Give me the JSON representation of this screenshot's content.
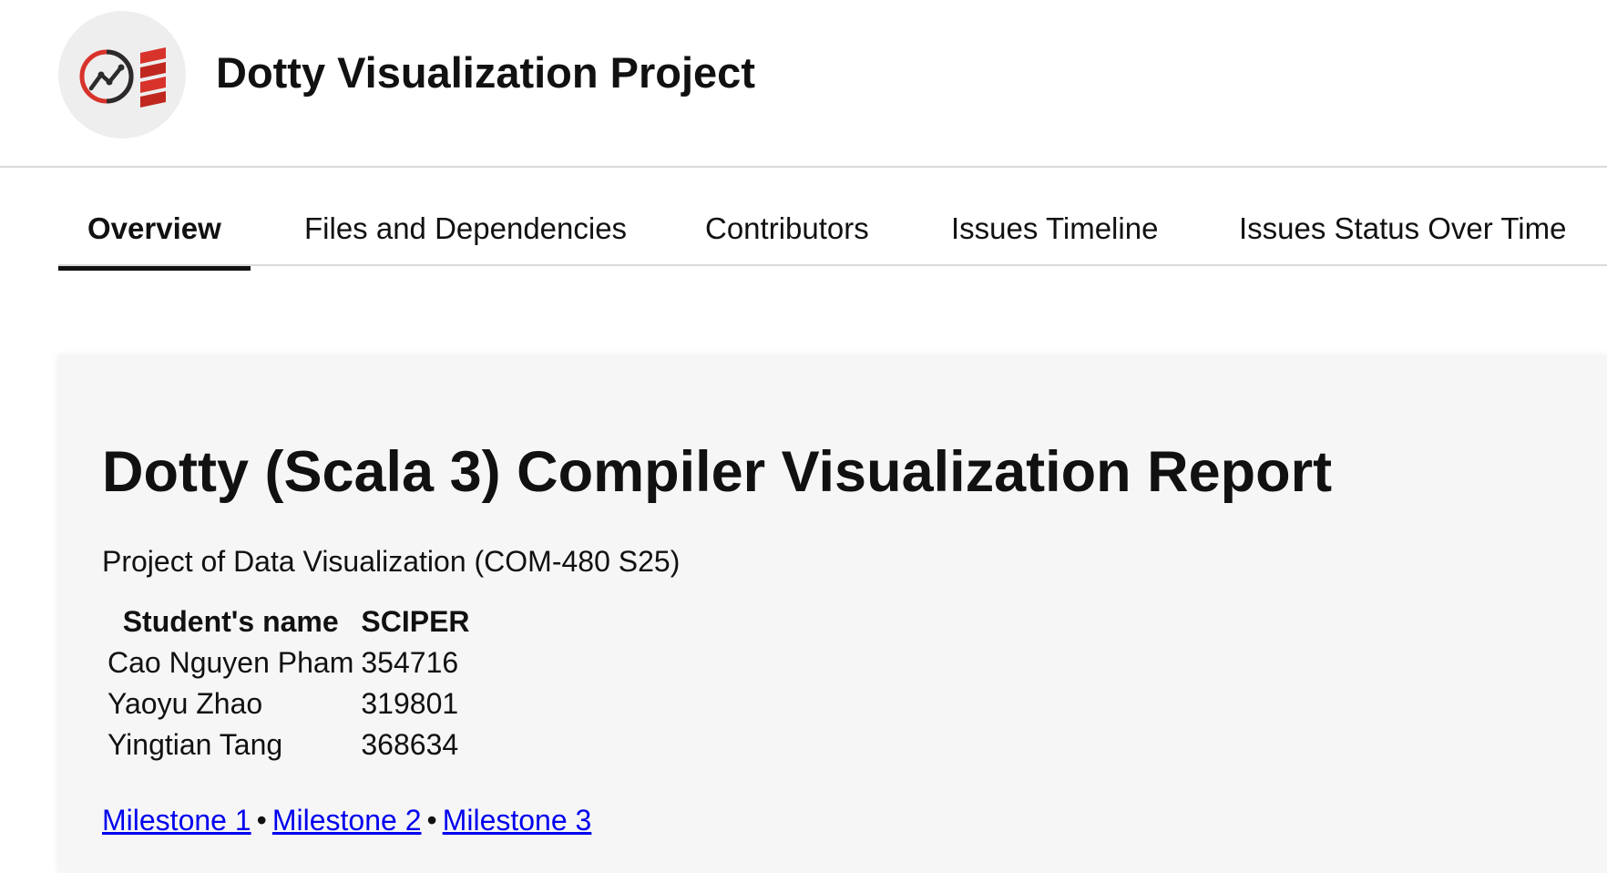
{
  "header": {
    "title": "Dotty Visualization Project",
    "logo": "chart-scala-logo-icon"
  },
  "tabs": [
    {
      "label": "Overview",
      "active": true
    },
    {
      "label": "Files and Dependencies",
      "active": false
    },
    {
      "label": "Contributors",
      "active": false
    },
    {
      "label": "Issues Timeline",
      "active": false
    },
    {
      "label": "Issues Status Over Time",
      "active": false
    }
  ],
  "report": {
    "title": "Dotty (Scala 3) Compiler Visualization Report",
    "subtitle": "Project of Data Visualization (COM-480 S25)",
    "table": {
      "headers": [
        "Student's name",
        "SCIPER"
      ],
      "rows": [
        [
          "Cao Nguyen Pham",
          "354716"
        ],
        [
          "Yaoyu Zhao",
          "319801"
        ],
        [
          "Yingtian Tang",
          "368634"
        ]
      ]
    },
    "links": [
      "Milestone 1",
      "Milestone 2",
      "Milestone 3"
    ],
    "link_separator": "•"
  },
  "colors": {
    "link": "#0000ee",
    "card_background": "#f6f6f6",
    "logo_red": "#d8332b",
    "logo_dark": "#2b2b2b"
  }
}
